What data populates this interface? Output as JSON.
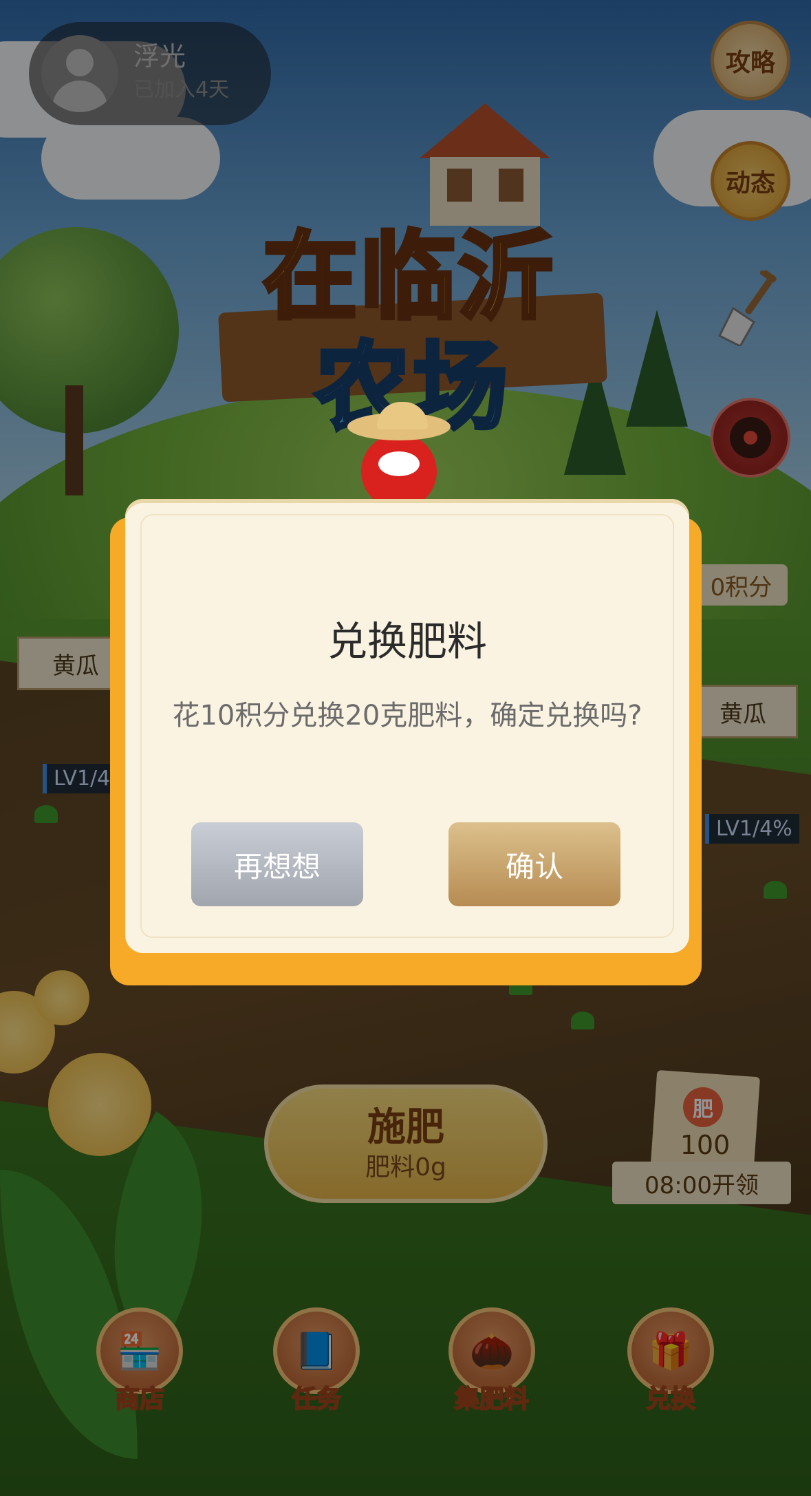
{
  "user": {
    "name": "浮光",
    "joined": "已加入4天"
  },
  "side": {
    "guide": "攻略",
    "feed": "动态"
  },
  "logo": {
    "line1": "在临沂",
    "line2": "农场"
  },
  "farm": {
    "left_crop": "黄瓜",
    "left_level": "LV1/4",
    "right_crop": "黄瓜",
    "right_level": "LV1/4%",
    "points": "0积分"
  },
  "fertilize": {
    "label": "施肥",
    "amount": "肥料0g"
  },
  "reward": {
    "badge": "肥",
    "amount": "100",
    "time": "08:00开领"
  },
  "nav": [
    {
      "label": "商店"
    },
    {
      "label": "任务"
    },
    {
      "label": "集肥料"
    },
    {
      "label": "兑换"
    }
  ],
  "modal": {
    "title": "兑换肥料",
    "message": "花10积分兑换20克肥料，确定兑换吗?",
    "cancel": "再想想",
    "confirm": "确认"
  },
  "colors": {
    "accent": "#f7a928",
    "confirm": "#b68c52",
    "cancel": "#a1a5ad"
  }
}
